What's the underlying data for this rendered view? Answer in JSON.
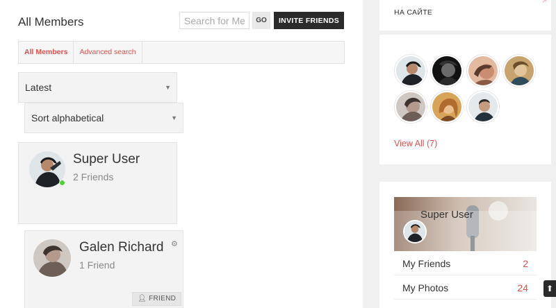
{
  "members": {
    "title": "All Members",
    "search": {
      "placeholder": "Search for Members"
    },
    "go_label": "GO",
    "invite_label": "INVITE FRIENDS",
    "tabs": [
      {
        "label": "All Members",
        "active": true
      },
      {
        "label": "Advanced search",
        "active": false
      }
    ],
    "filter": {
      "selected": "Latest"
    },
    "sort": {
      "selected": "Sort alphabetical"
    },
    "list": [
      {
        "name": "Super User",
        "friends": "2 Friends",
        "online": true
      },
      {
        "name": "Galen Richard",
        "friends": "1 Friend",
        "online": false,
        "action": "FRIEND"
      }
    ]
  },
  "sidebar": {
    "online_heading": "НА САЙТЕ",
    "view_all": "View All (7)",
    "user": {
      "name": "Super User",
      "menu": [
        {
          "label": "My Friends",
          "count": "2"
        },
        {
          "label": "My Photos",
          "count": "24"
        }
      ]
    }
  },
  "colors": {
    "accent": "#d9534f",
    "online": "#4cd137",
    "dark_button": "#2b2b2b"
  }
}
